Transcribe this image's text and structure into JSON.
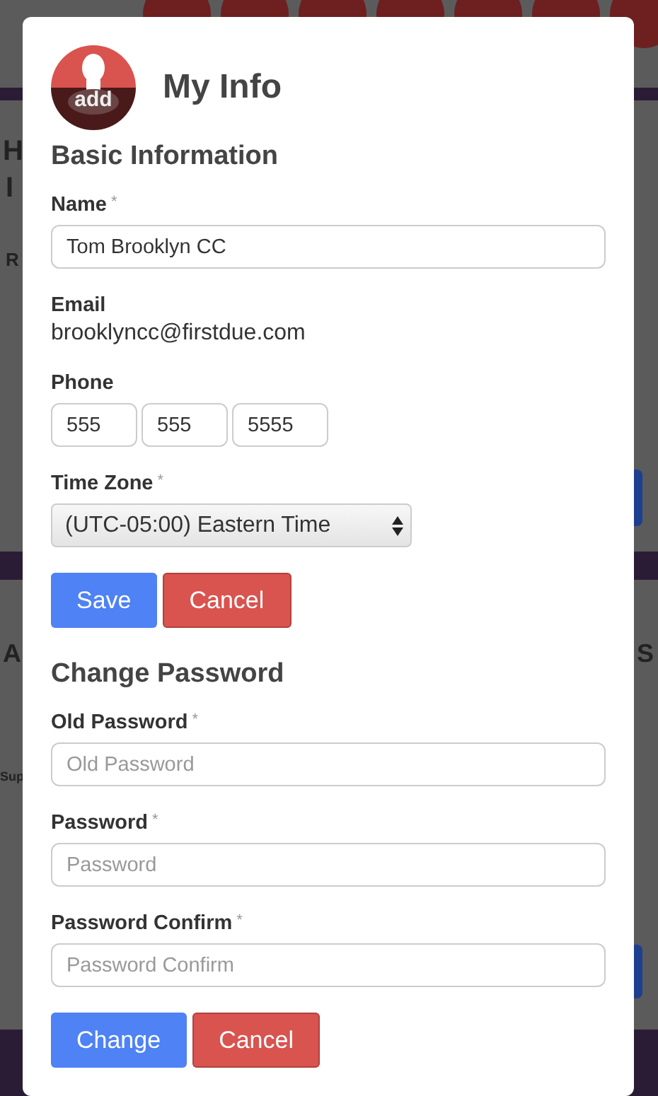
{
  "backdrop": {
    "fragments": [
      {
        "text": "H"
      },
      {
        "text": "I"
      },
      {
        "text": "R"
      },
      {
        "text": "A"
      },
      {
        "text": "Sup"
      },
      {
        "text": "S"
      }
    ]
  },
  "modal": {
    "avatar": {
      "badge": "add"
    },
    "title": "My Info",
    "sections": [
      {
        "heading": "Basic Information",
        "fields": [
          {
            "kind": "text",
            "label": "Name",
            "required_mark": "*",
            "value": "Tom Brooklyn CC"
          },
          {
            "kind": "static",
            "label": "Email",
            "value": "brooklyncc@firstdue.com"
          },
          {
            "kind": "phone",
            "label": "Phone",
            "parts": [
              "555",
              "555",
              "5555"
            ]
          },
          {
            "kind": "select",
            "label": "Time Zone",
            "required_mark": "*",
            "value": "(UTC-05:00) Eastern Time"
          }
        ],
        "buttons": [
          {
            "label": "Save",
            "kind": "primary"
          },
          {
            "label": "Cancel",
            "kind": "danger"
          }
        ]
      },
      {
        "heading": "Change Password",
        "fields": [
          {
            "kind": "password",
            "label": "Old Password",
            "required_mark": "*",
            "placeholder": "Old Password"
          },
          {
            "kind": "password",
            "label": "Password",
            "required_mark": "*",
            "placeholder": "Password"
          },
          {
            "kind": "password",
            "label": "Password Confirm",
            "required_mark": "*",
            "placeholder": "Password Confirm"
          }
        ],
        "buttons": [
          {
            "label": "Change",
            "kind": "primary"
          },
          {
            "label": "Cancel",
            "kind": "danger"
          }
        ]
      }
    ]
  }
}
